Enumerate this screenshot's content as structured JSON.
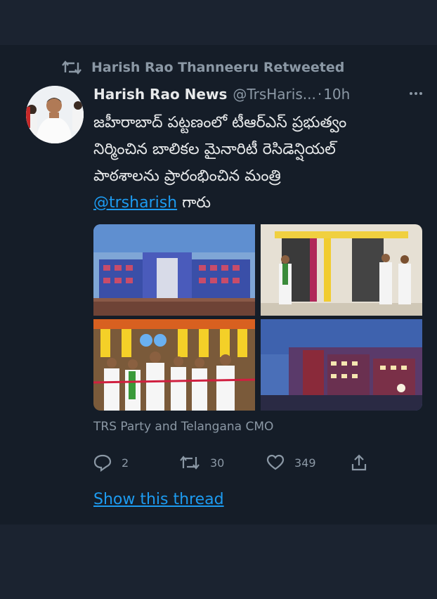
{
  "retweet": {
    "icon": "retweet-icon",
    "text": "Harish Rao Thanneeru Retweeted"
  },
  "author": {
    "name": "Harish Rao News",
    "handle": "@TrsHaris...",
    "separator": "·",
    "time": "10h"
  },
  "tweet": {
    "text_lines": [
      "జహీరాబాద్ పట్టణంలో టీఆర్ఎస్ ప్రభుత్వం",
      "నిర్మించిన బాలికల మైనారిటీ రెసిడెన్షియల్",
      "పాఠశాలను ప్రారంభించిన మంత్రి"
    ],
    "mention": "@trsharish",
    "suffix": " గారు"
  },
  "media": {
    "images": [
      "building-photo",
      "inauguration-plaque-photo",
      "ribbon-cutting-photo",
      "building-night-photo"
    ]
  },
  "attribution": "TRS Party and Telangana CMO",
  "actions": {
    "replies": "2",
    "retweets": "30",
    "likes": "349"
  },
  "show_thread": "Show this thread",
  "colors": {
    "background": "#1b2330",
    "card": "#151d28",
    "text": "#e7e9ea",
    "muted": "#8b98a5",
    "link": "#1d9bf0"
  }
}
